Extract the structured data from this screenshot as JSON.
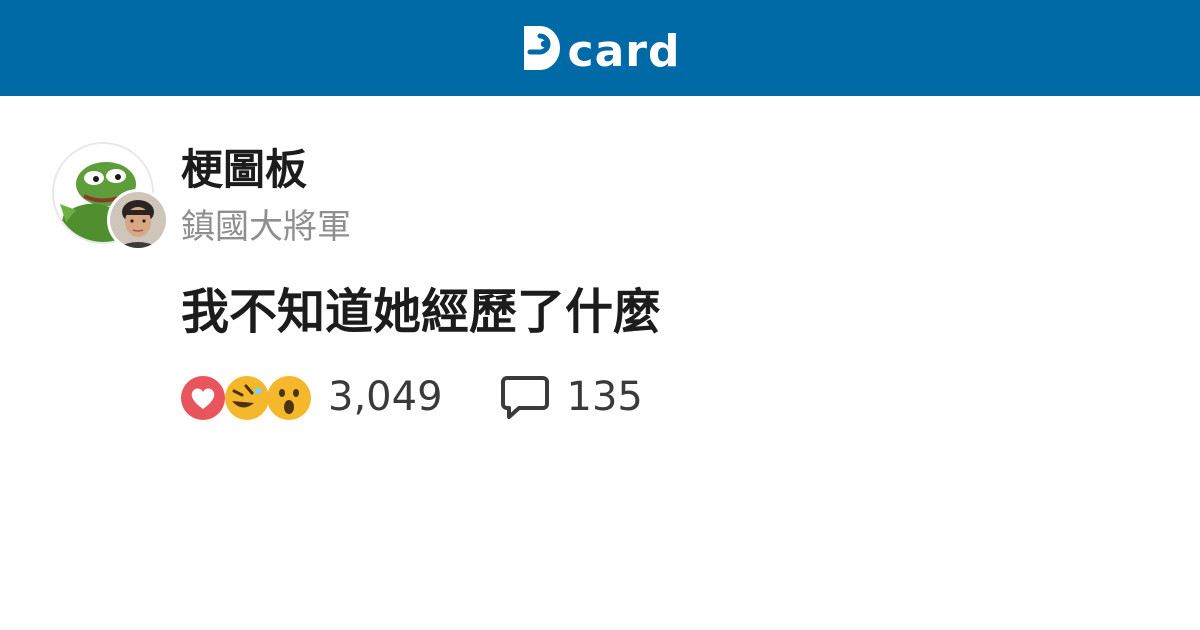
{
  "header": {
    "brand": "card",
    "brand_color": "#006aa6",
    "logo_icon": "dcard-logo-icon"
  },
  "post": {
    "forum_name": "梗圖板",
    "author_name": "鎮國大將軍",
    "title": "我不知道她經歷了什麼",
    "forum_avatar": "frog-meme-avatar",
    "author_avatar": "user-photo-avatar"
  },
  "stats": {
    "reaction_icons": [
      "heart-reaction-icon",
      "laugh-reaction-icon",
      "wow-reaction-icon"
    ],
    "reaction_count": "3,049",
    "comment_icon": "comment-bubble-icon",
    "comment_count": "135"
  },
  "colors": {
    "heart": "#e8555d",
    "emoji": "#f5b72b",
    "text_secondary": "#8f8f8f"
  }
}
